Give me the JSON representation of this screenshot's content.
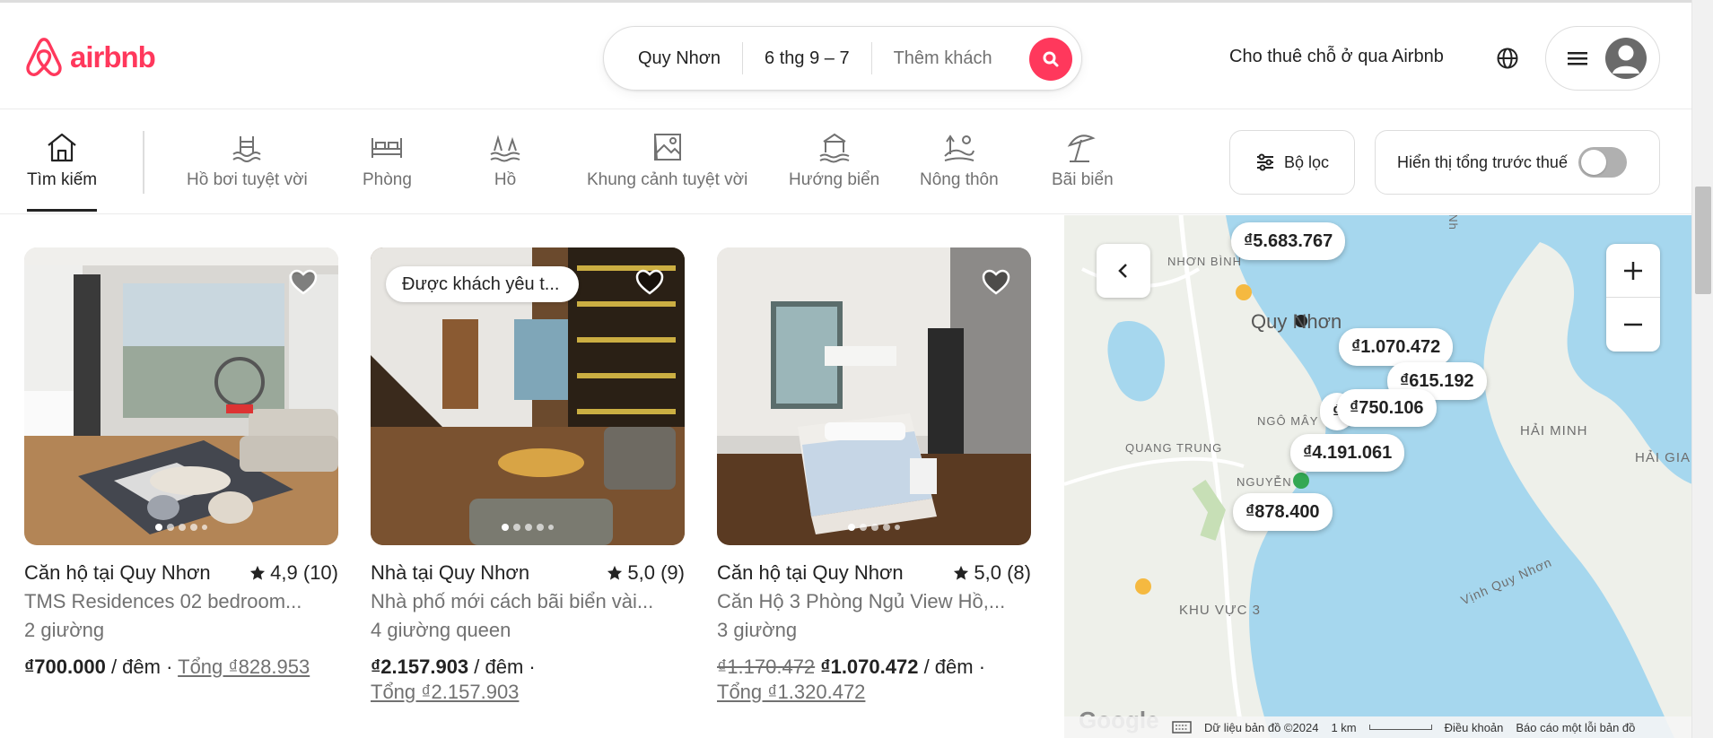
{
  "brand": {
    "name": "airbnb",
    "color": "#ff385c"
  },
  "search": {
    "location": "Quy Nhơn",
    "dates": "6 thg 9 – 7",
    "guests_placeholder": "Thêm khách"
  },
  "header": {
    "host_link": "Cho thuê chỗ ở qua Airbnb"
  },
  "categories": [
    {
      "label": "Tìm kiếm",
      "icon": "home-icon",
      "active": true
    },
    {
      "label": "Hồ bơi tuyệt vời",
      "icon": "pool-icon"
    },
    {
      "label": "Phòng",
      "icon": "bed-icon"
    },
    {
      "label": "Hồ",
      "icon": "lake-icon"
    },
    {
      "label": "Khung cảnh tuyệt vời",
      "icon": "view-icon"
    },
    {
      "label": "Hướng biển",
      "icon": "beachfront-icon"
    },
    {
      "label": "Nông thôn",
      "icon": "countryside-icon"
    },
    {
      "label": "Bãi biển",
      "icon": "beach-umbrella-icon"
    }
  ],
  "filters": {
    "label": "Bộ lọc",
    "tax_toggle_label": "Hiển thị tổng trước thuế",
    "tax_toggle_on": false
  },
  "listings": [
    {
      "title": "Căn hộ tại Quy Nhơn",
      "rating": "4,9 (10)",
      "subtitle": "TMS Residences 02 bedroom...",
      "beds": "2 giường",
      "price": "₫700.000",
      "per_night": " / đêm · ",
      "total": "Tổng ₫828.953",
      "badge": ""
    },
    {
      "title": "Nhà tại Quy Nhơn",
      "rating": "5,0 (9)",
      "subtitle": "Nhà phố mới cách bãi biển vài...",
      "beds": "4 giường queen",
      "price": "₫2.157.903",
      "per_night": " / đêm ·",
      "total": "Tổng ₫2.157.903",
      "badge": "Được khách yêu t..."
    },
    {
      "title": "Căn hộ tại Quy Nhơn",
      "rating": "5,0 (8)",
      "subtitle": "Căn Hộ 3 Phòng Ngủ View Hồ,...",
      "beds": "3 giường",
      "original_price": "₫1.170.472",
      "price": "₫1.070.472",
      "per_night": " / đêm ·",
      "total": "Tổng ₫1.320.472",
      "badge": ""
    }
  ],
  "map": {
    "city_label": "Quy Nhơn",
    "area_labels": [
      "NHƠN BÌNH",
      "NGÔ MÂY",
      "QUANG TRUNG",
      "NGUYỄN",
      "HẢI MINH",
      "HẢI GIA",
      "KHU VỰC 3",
      "Vịnh Quy Nhơn",
      "Nh"
    ],
    "pins": [
      "₫5.683.767",
      "₫1.070.472",
      "₫615.192",
      "₫750.106",
      "₫4.191.061",
      "₫878.400",
      "₫"
    ],
    "footer": {
      "google": "Google",
      "data": "Dữ liệu bản đồ ©2024",
      "scale": "1 km",
      "terms": "Điều khoản",
      "report": "Báo cáo một lỗi bản đồ"
    }
  }
}
